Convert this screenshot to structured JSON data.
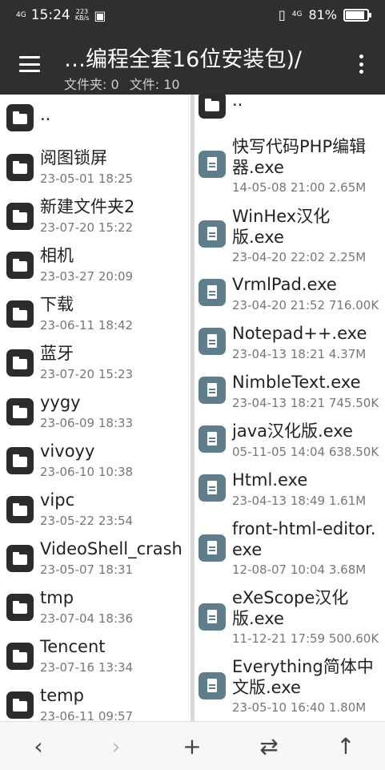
{
  "status_bar": {
    "signal": "4G",
    "time": "15:24",
    "speed": "223",
    "speed_unit": "KB/s",
    "network": "4G",
    "battery": "81%"
  },
  "header": {
    "title": "…编程全套16位安装包)/",
    "info": {
      "folders": "文件夹: 0",
      "files": "文件: 10"
    }
  },
  "left_pane": {
    "items": [
      {
        "name": "..",
        "date": "",
        "type": "folder"
      },
      {
        "name": "阅图锁屏",
        "date": "23-05-01 18:25",
        "type": "folder"
      },
      {
        "name": "新建文件夹2",
        "date": "23-07-20 15:22",
        "type": "folder"
      },
      {
        "name": "相机",
        "date": "23-03-27 20:09",
        "type": "folder"
      },
      {
        "name": "下载",
        "date": "23-06-11 18:42",
        "type": "folder"
      },
      {
        "name": "蓝牙",
        "date": "23-07-20 15:23",
        "type": "folder"
      },
      {
        "name": "yygy",
        "date": "23-06-09 18:33",
        "type": "folder"
      },
      {
        "name": "vivoyy",
        "date": "23-06-10 10:38",
        "type": "folder"
      },
      {
        "name": "vipc",
        "date": "23-05-22 23:54",
        "type": "folder"
      },
      {
        "name": "VideoShell_crash",
        "date": "23-05-07 18:31",
        "type": "folder"
      },
      {
        "name": "tmp",
        "date": "23-07-04 18:36",
        "type": "folder"
      },
      {
        "name": "Tencent",
        "date": "23-07-16 13:34",
        "type": "folder"
      },
      {
        "name": "temp",
        "date": "23-06-11 09:57",
        "type": "folder"
      }
    ]
  },
  "right_pane": {
    "items": [
      {
        "name_l1": "..",
        "name_l2": "",
        "meta": "",
        "type": "folder"
      },
      {
        "name_l1": "快写代码PHP编辑",
        "name_l2": "器.exe",
        "meta": "14-05-08 21:00 2.65M",
        "type": "file"
      },
      {
        "name_l1": "WinHex汉化",
        "name_l2": "版.exe",
        "meta": "23-04-20 22:02 2.25M",
        "type": "file"
      },
      {
        "name_l1": "VrmlPad.exe",
        "name_l2": "",
        "meta": "23-04-20 21:52 716.00K",
        "type": "file"
      },
      {
        "name_l1": "Notepad++.exe",
        "name_l2": "",
        "meta": "23-04-13 18:21 4.37M",
        "type": "file"
      },
      {
        "name_l1": "NimbleText.exe",
        "name_l2": "",
        "meta": "23-04-13 18:21 745.50K",
        "type": "file"
      },
      {
        "name_l1": "java汉化版.exe",
        "name_l2": "",
        "meta": "05-11-05 14:04 638.50K",
        "type": "file"
      },
      {
        "name_l1": "Html.exe",
        "name_l2": "",
        "meta": "23-04-13 18:49 1.61M",
        "type": "file"
      },
      {
        "name_l1": "front-html-editor.",
        "name_l2": "exe",
        "meta": "12-08-07 10:04 3.68M",
        "type": "file"
      },
      {
        "name_l1": "eXeScope汉化",
        "name_l2": "版.exe",
        "meta": "11-12-21 17:59 500.60K",
        "type": "file"
      },
      {
        "name_l1": "Everything简体中",
        "name_l2": "文版.exe",
        "meta": "23-05-10 16:40 1.80M",
        "type": "file"
      }
    ]
  },
  "bottom_bar": {
    "back": "‹",
    "forward": "›",
    "add": "+",
    "swap": "⇄",
    "up": "↑"
  }
}
